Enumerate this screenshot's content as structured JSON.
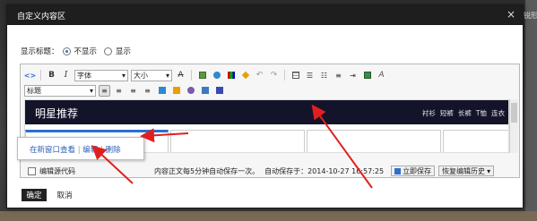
{
  "background": {
    "cut_text": "锐形"
  },
  "dialog": {
    "title": "自定义内容区",
    "close_glyph": "×",
    "show_title": {
      "label": "显示标题：",
      "options": [
        {
          "label": "不显示",
          "selected": true
        },
        {
          "label": "显示",
          "selected": false
        }
      ]
    },
    "toolbar": {
      "row1": {
        "source_glyph": "<>",
        "bold": "B",
        "italic": "I",
        "font_family": "字体",
        "font_size": "大小",
        "strike": "A",
        "undo": "↶",
        "redo": "↷",
        "format_glyph": "A"
      },
      "row2": {
        "paragraph_format": "标题"
      }
    },
    "content": {
      "banner_title": "明星推荐",
      "banner_nav": [
        "衬衫",
        "短裤",
        "长裤",
        "T恤",
        "连衣"
      ]
    },
    "popup": {
      "open_new_window": "在新窗口查看",
      "sep1": "|",
      "edit": "编辑",
      "sep2": "|",
      "delete": "删除"
    },
    "status": {
      "edit_source": "编辑源代码",
      "autosave_note": "内容正文每5分钟自动保存一次。",
      "autosave_time": "自动保存于：2014-10-27 16:57:25",
      "save_now": "立即保存",
      "restore_history": "恢复编辑历史"
    },
    "footer": {
      "ok": "确定",
      "cancel": "取消"
    }
  },
  "colors": {
    "titlebar": "#1e1e1e",
    "banner": "#13142a",
    "link": "#2b5fb3",
    "arrow": "#e02020"
  }
}
